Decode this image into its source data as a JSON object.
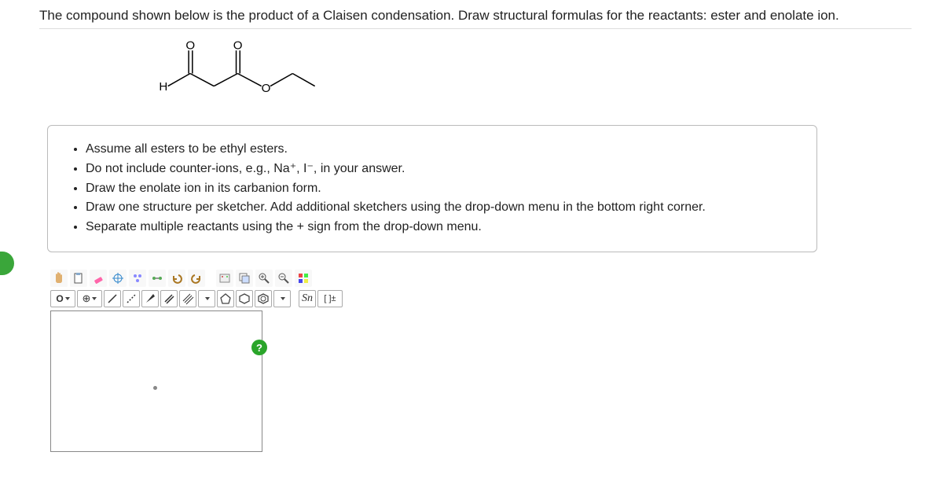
{
  "question": "The compound shown below is the product of a Claisen condensation. Draw structural formulas for the reactants: ester and enolate ion.",
  "structure_labels": {
    "H": "H",
    "O1": "O",
    "O2": "O",
    "O3": "O"
  },
  "instructions": [
    "Assume all esters to be ethyl esters.",
    "Do not include counter-ions, e.g., Na⁺, I⁻, in your answer.",
    "Draw the enolate ion in its carbanion form.",
    "Draw one structure per sketcher. Add additional sketchers using the drop-down menu in the bottom right corner.",
    "Separate multiple reactants using the + sign from the drop-down menu."
  ],
  "toolbar1": {
    "hand": "✋",
    "paste": "📋",
    "erase": "✏",
    "center": "✳",
    "clean": "⚗",
    "clean2": "⚙",
    "undo": "↶",
    "redo": "↷",
    "cut": "✂",
    "copy": "⎘",
    "zoomin": "+",
    "zoomout": "−",
    "color": "🎨"
  },
  "toolbar2": {
    "atom": "O",
    "add": "⊕",
    "bond_single": "/",
    "bond_dash": "⋰",
    "bond_wedge": "◢",
    "bond_double": "⫽",
    "bond_triple": "⫼",
    "ring1": "▢",
    "ring2": "⬠",
    "ring3": "⬡",
    "sn": "Sn",
    "charge": "[ ]±"
  },
  "help": "?"
}
